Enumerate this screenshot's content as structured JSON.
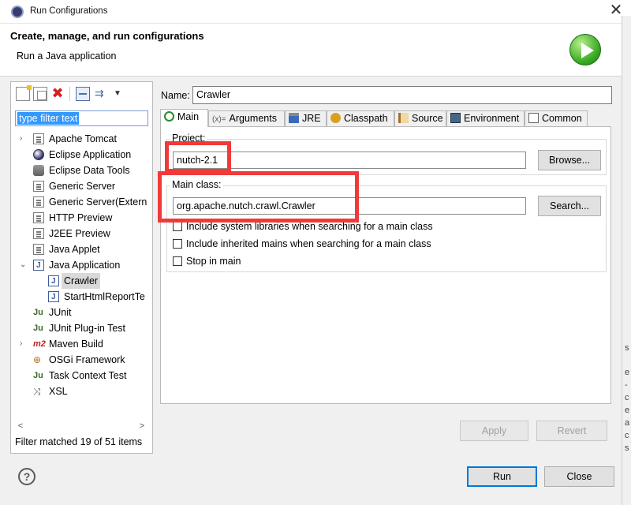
{
  "window": {
    "title": "Run Configurations",
    "close_glyph": "✕"
  },
  "header": {
    "title": "Create, manage, and run configurations",
    "subtitle": "Run a Java application"
  },
  "left_panel": {
    "filter_placeholder": "type filter text",
    "tree": [
      {
        "label": "Apache Tomcat",
        "icon": "tomcat-icon",
        "expandable": true
      },
      {
        "label": "Eclipse Application",
        "icon": "eclipse-icon",
        "expandable": false
      },
      {
        "label": "Eclipse Data Tools",
        "icon": "database-icon",
        "expandable": false
      },
      {
        "label": "Generic Server",
        "icon": "server-doc-icon",
        "expandable": false
      },
      {
        "label": "Generic Server(Extern",
        "icon": "server-doc-icon",
        "expandable": false
      },
      {
        "label": "HTTP Preview",
        "icon": "preview-doc-icon",
        "expandable": false
      },
      {
        "label": "J2EE Preview",
        "icon": "preview-doc-icon",
        "expandable": false
      },
      {
        "label": "Java Applet",
        "icon": "applet-icon",
        "expandable": false
      },
      {
        "label": "Java Application",
        "icon": "java-app-icon",
        "expandable": true,
        "expanded": true
      },
      {
        "label": "Crawler",
        "icon": "java-app-icon",
        "child": true,
        "selected": true
      },
      {
        "label": "StartHtmlReportTe",
        "icon": "java-app-icon",
        "child": true
      },
      {
        "label": "JUnit",
        "icon": "junit-icon",
        "expandable": false
      },
      {
        "label": "JUnit Plug-in Test",
        "icon": "junit-plugin-icon",
        "expandable": false
      },
      {
        "label": "Maven Build",
        "icon": "maven-icon",
        "expandable": true
      },
      {
        "label": "OSGi Framework",
        "icon": "osgi-icon",
        "expandable": false
      },
      {
        "label": "Task Context Test",
        "icon": "task-junit-icon",
        "expandable": false
      },
      {
        "label": "XSL",
        "icon": "xsl-icon",
        "expandable": false
      }
    ],
    "filter_status": "Filter matched 19 of 51 items",
    "glyphs": {
      "collapsed": "›",
      "expanded": "⌄",
      "scroll_left": "<",
      "scroll_right": ">",
      "delete": "✖",
      "filter": "⇉",
      "menu": "▼",
      "ju": "Ju",
      "m2": "m2",
      "osgi": "⊕",
      "xsl": "⤨"
    }
  },
  "config": {
    "name_label": "Name:",
    "name_value": "Crawler",
    "tabs": [
      {
        "label": "Main",
        "icon": "main-tab-icon",
        "active": true
      },
      {
        "label": "Arguments",
        "icon": "arguments-icon",
        "prefix": "(x)="
      },
      {
        "label": "JRE",
        "icon": "jre-icon"
      },
      {
        "label": "Classpath",
        "icon": "classpath-icon"
      },
      {
        "label": "Source",
        "icon": "source-icon"
      },
      {
        "label": "Environment",
        "icon": "environment-icon"
      },
      {
        "label": "Common",
        "icon": "common-icon"
      }
    ],
    "project_label": "Project:",
    "project_value": "nutch-2.1",
    "browse_label": "Browse...",
    "main_class_label": "Main class:",
    "main_class_value": "org.apache.nutch.crawl.Crawler",
    "search_label": "Search...",
    "checkboxes": [
      {
        "label": "Include system libraries when searching for a main class",
        "checked": false
      },
      {
        "label": "Include inherited mains when searching for a main class",
        "checked": false
      },
      {
        "label": "Stop in main",
        "checked": false
      }
    ],
    "apply_label": "Apply",
    "revert_label": "Revert"
  },
  "footer": {
    "help_glyph": "?",
    "run_label": "Run",
    "close_label": "Close"
  },
  "highlight_color": "#f03a3a",
  "background_edge": [
    "s",
    "e",
    "-",
    "c",
    "e",
    "a",
    "c",
    "s"
  ]
}
